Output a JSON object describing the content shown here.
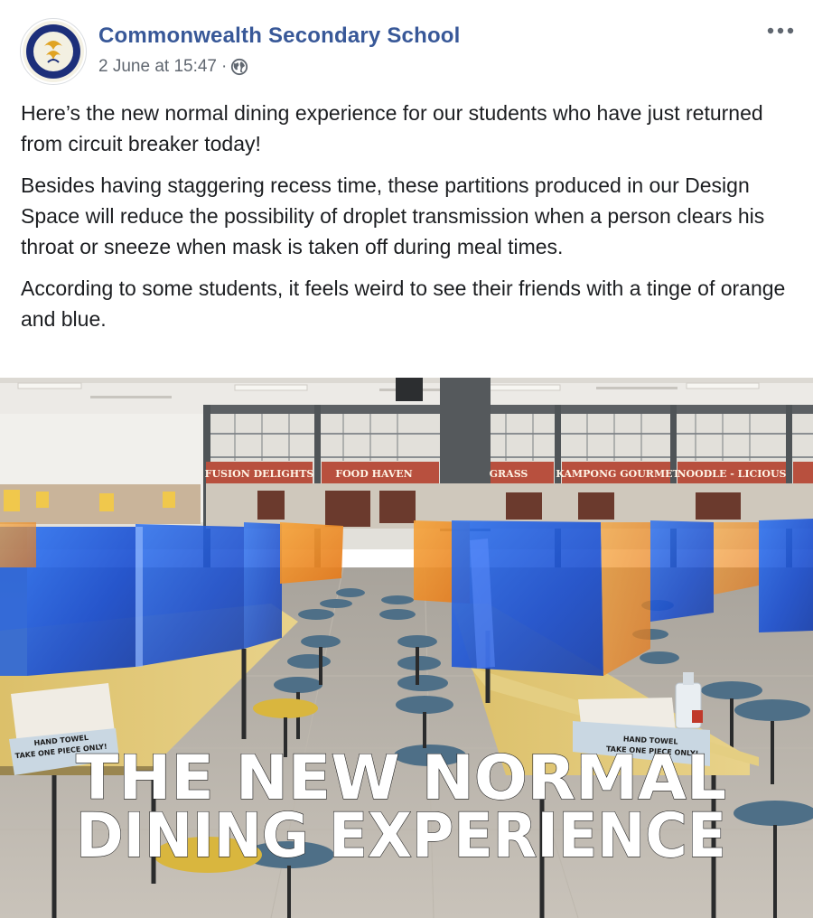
{
  "post": {
    "page_name": "Commonwealth Secondary School",
    "timestamp": "2 June at 15:47",
    "separator": "·",
    "privacy_icon": "globe-icon",
    "more_icon": "more-dots-icon",
    "paragraphs": [
      "Here’s the new normal dining experience for our students who have just returned from circuit breaker today!",
      "Besides having staggering recess time, these partitions produced in our Design Space will reduce the possibility of droplet transmission when a person clears his throat or sneeze when mask is taken off during meal times.",
      "According to some students, it feels weird to see their friends with a tinge of orange and blue."
    ]
  },
  "photo": {
    "stall_signs": [
      "FUSION DELIGHTS",
      "FOOD HAVEN",
      "GRASS",
      "KAMPONG GOURMET",
      "NOODLE - LICIOUS"
    ],
    "caption_line1": "THE NEW NORMAL",
    "caption_line2": "DINING EXPERIENCE",
    "towel_label_left_1": "HAND TOWEL",
    "towel_label_left_2": "TAKE ONE PIECE ONLY!",
    "towel_label_right_1": "HAND TOWEL",
    "towel_label_right_2": "TAKE ONE PIECE ONLY!"
  },
  "colors": {
    "link": "#385898",
    "meta": "#606770",
    "text": "#1c1e21",
    "partition_blue": "#1f5ad6",
    "partition_orange": "#f08a1c",
    "caption": "#ffffff"
  }
}
